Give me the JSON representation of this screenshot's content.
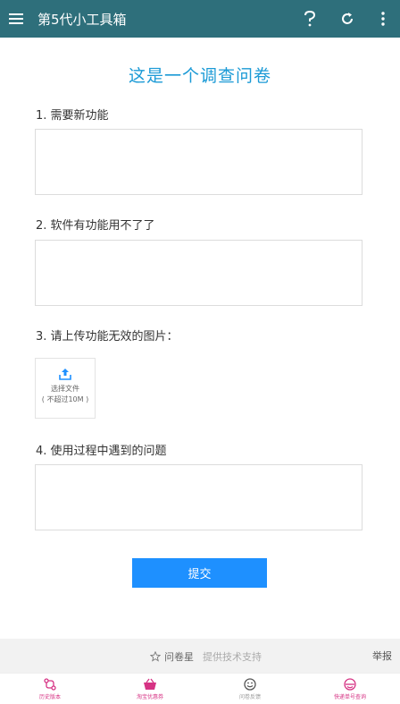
{
  "app": {
    "title": "第5代小工具箱",
    "colors": {
      "appbar": "#2e6f7b",
      "accent": "#1b9ad6",
      "button": "#1e90ff",
      "nav": "#d63384"
    }
  },
  "form": {
    "title": "这是一个调查问卷",
    "questions": [
      {
        "label": "1. 需要新功能"
      },
      {
        "label": "2. 软件有功能用不了了"
      },
      {
        "label": "3. 请上传功能无效的图片："
      },
      {
        "label": "4. 使用过程中遇到的问题"
      }
    ],
    "upload": {
      "line1": "选择文件",
      "line2": "( 不超过10M )"
    },
    "submit_label": "提交"
  },
  "footer": {
    "brand": "问卷星",
    "tech": "提供技术支持",
    "report": "举报"
  },
  "bottom_nav": [
    {
      "label": "历史版本",
      "icon": "history-icon"
    },
    {
      "label": "淘宝优惠券",
      "icon": "basket-icon"
    },
    {
      "label": "问卷反馈",
      "icon": "smiley-icon"
    },
    {
      "label": "快递单号查询",
      "icon": "courier-icon"
    }
  ]
}
